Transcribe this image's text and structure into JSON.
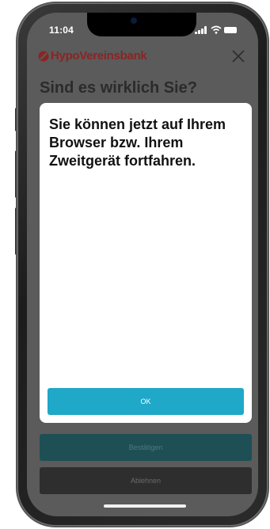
{
  "status_bar": {
    "time": "11:04"
  },
  "header": {
    "brand": "HypoVereinsbank",
    "brand_color": "#8b2424"
  },
  "background": {
    "title": "Sind es wirklich Sie?"
  },
  "modal": {
    "message": "Sie können jetzt auf Ihrem Browser bzw. Ihrem Zweitgerät fortfahren.",
    "ok_label": "OK",
    "ok_color": "#1fa8c7"
  },
  "actions": {
    "confirm_label": "Bestätigen",
    "reject_label": "Ablehnen"
  },
  "icons": [
    "signal-icon",
    "wifi-icon",
    "battery-icon",
    "close-icon",
    "brand-logo-icon"
  ]
}
